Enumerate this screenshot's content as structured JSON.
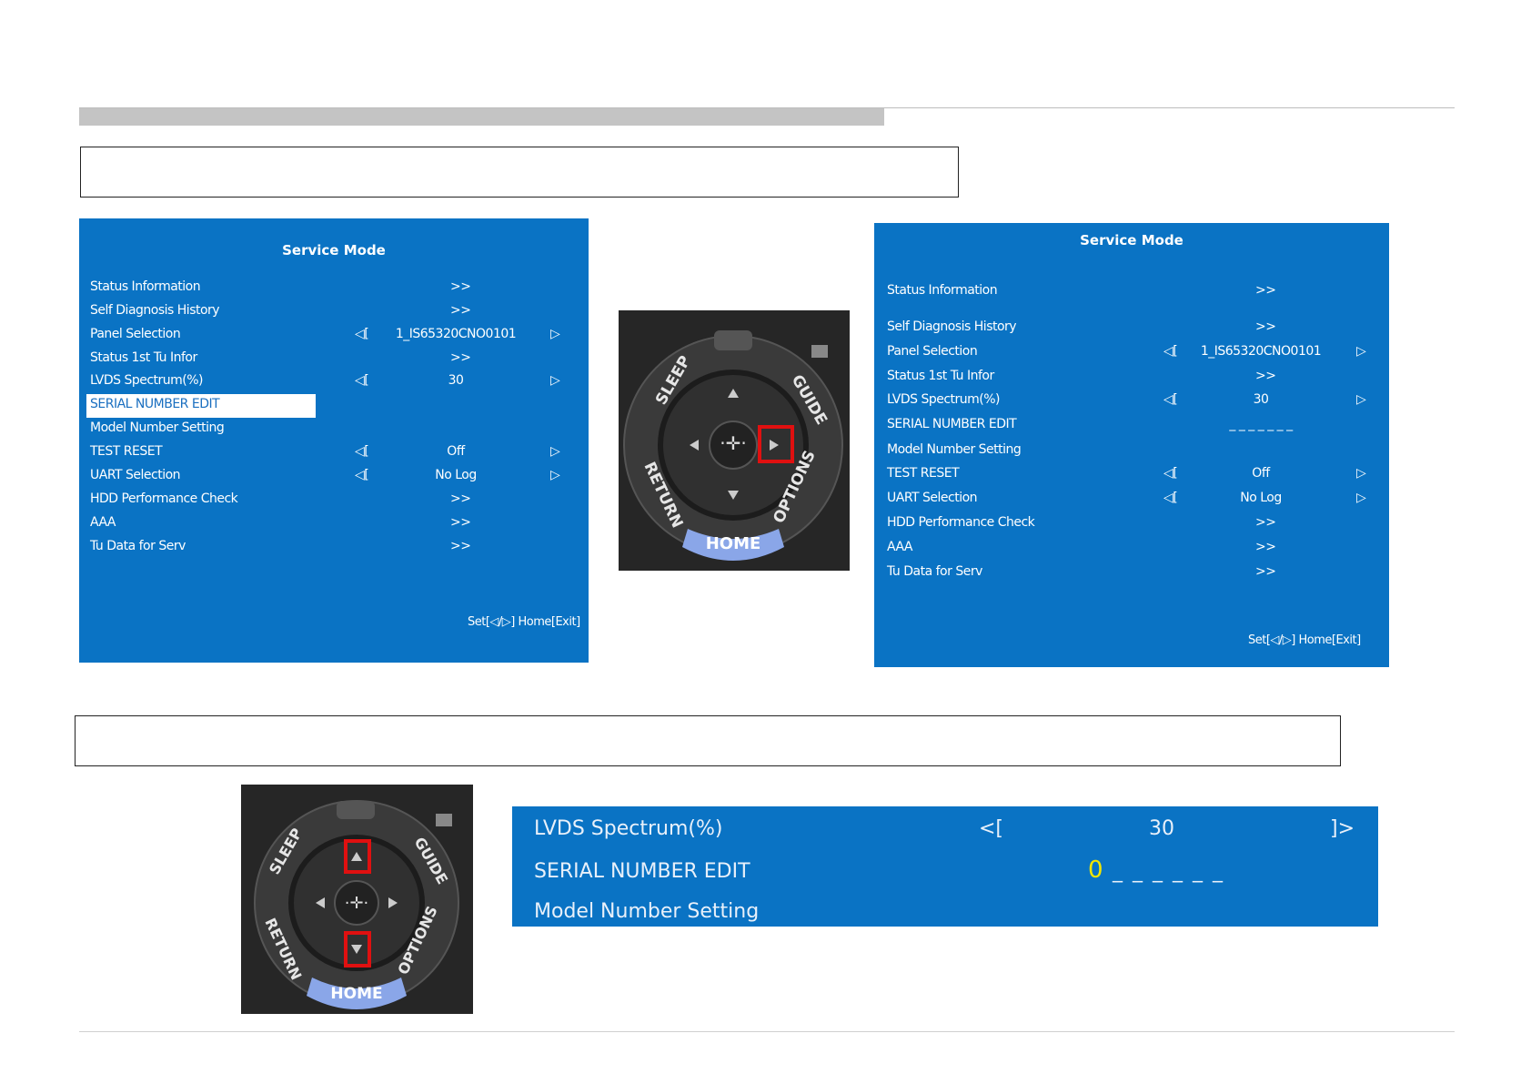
{
  "panel_left": {
    "title": "Service Mode",
    "rows": [
      {
        "label": "Status Information",
        "left": "",
        "value": ">>",
        "right": ""
      },
      {
        "label": "Self Diagnosis History",
        "left": "",
        "value": ">>",
        "right": ""
      },
      {
        "label": "Panel Selection",
        "left": "◁[",
        "value": "1_IS65320CNO0101",
        "right": "▷"
      },
      {
        "label": "Status 1st Tu Infor",
        "left": "",
        "value": ">>",
        "right": ""
      },
      {
        "label": "LVDS Spectrum(%)",
        "left": "◁[",
        "value": "30",
        "right": "▷"
      },
      {
        "label": "SERIAL NUMBER EDIT",
        "left": "",
        "value": "",
        "right": ""
      },
      {
        "label": "Model Number Setting",
        "left": "",
        "value": "",
        "right": ""
      },
      {
        "label": "TEST RESET",
        "left": "◁[",
        "value": "Off",
        "right": "▷"
      },
      {
        "label": "UART Selection",
        "left": "◁[",
        "value": "No Log",
        "right": "▷"
      },
      {
        "label": "HDD Performance Check",
        "left": "",
        "value": ">>",
        "right": ""
      },
      {
        "label": "AAA",
        "left": "",
        "value": ">>",
        "right": ""
      },
      {
        "label": "Tu Data for Serv",
        "left": "",
        "value": ">>",
        "right": ""
      }
    ],
    "selected_index": 5,
    "footer": "Set[◁/▷] Home[Exit]"
  },
  "panel_right": {
    "title": "Service Mode",
    "rows": [
      {
        "label": "Status Information",
        "left": "",
        "value": ">>",
        "right": ""
      },
      {
        "label": "Self Diagnosis History",
        "left": "",
        "value": ">>",
        "right": ""
      },
      {
        "label": "Panel Selection",
        "left": "◁[",
        "value": "1_IS65320CNO0101",
        "right": "▷"
      },
      {
        "label": "Status 1st Tu Infor",
        "left": "",
        "value": ">>",
        "right": ""
      },
      {
        "label": "LVDS Spectrum(%)",
        "left": "◁[",
        "value": "30",
        "right": "▷"
      },
      {
        "label": "SERIAL NUMBER EDIT",
        "left": "",
        "value": "_ _ _ _ _ _ _",
        "right": ""
      },
      {
        "label": "Model Number Setting",
        "left": "",
        "value": "",
        "right": ""
      },
      {
        "label": "TEST RESET",
        "left": "◁[",
        "value": "Off",
        "right": "▷"
      },
      {
        "label": "UART Selection",
        "left": "◁[",
        "value": "No Log",
        "right": "▷"
      },
      {
        "label": "HDD Performance Check",
        "left": "",
        "value": ">>",
        "right": ""
      },
      {
        "label": "AAA",
        "left": "",
        "value": ">>",
        "right": ""
      },
      {
        "label": "Tu Data for Serv",
        "left": "",
        "value": ">>",
        "right": ""
      }
    ],
    "footer": "Set[◁/▷] Home[Exit]"
  },
  "zoom_panel": {
    "row1": {
      "label": "LVDS Spectrum(%)",
      "left": "<[",
      "value": "30",
      "right": "]>"
    },
    "row2": {
      "label": "SERIAL NUMBER EDIT",
      "digit": "0",
      "rest": "_ _ _ _ _ _"
    },
    "row3": {
      "label": "Model Number Setting"
    }
  },
  "remote": {
    "labels": {
      "sleep": "SLEEP",
      "guide": "GUIDE",
      "return": "RETURN",
      "options": "OPTIONS",
      "home": "HOME"
    },
    "highlight_color": "#e01010"
  },
  "captions": {
    "top": "",
    "bottom": ""
  }
}
